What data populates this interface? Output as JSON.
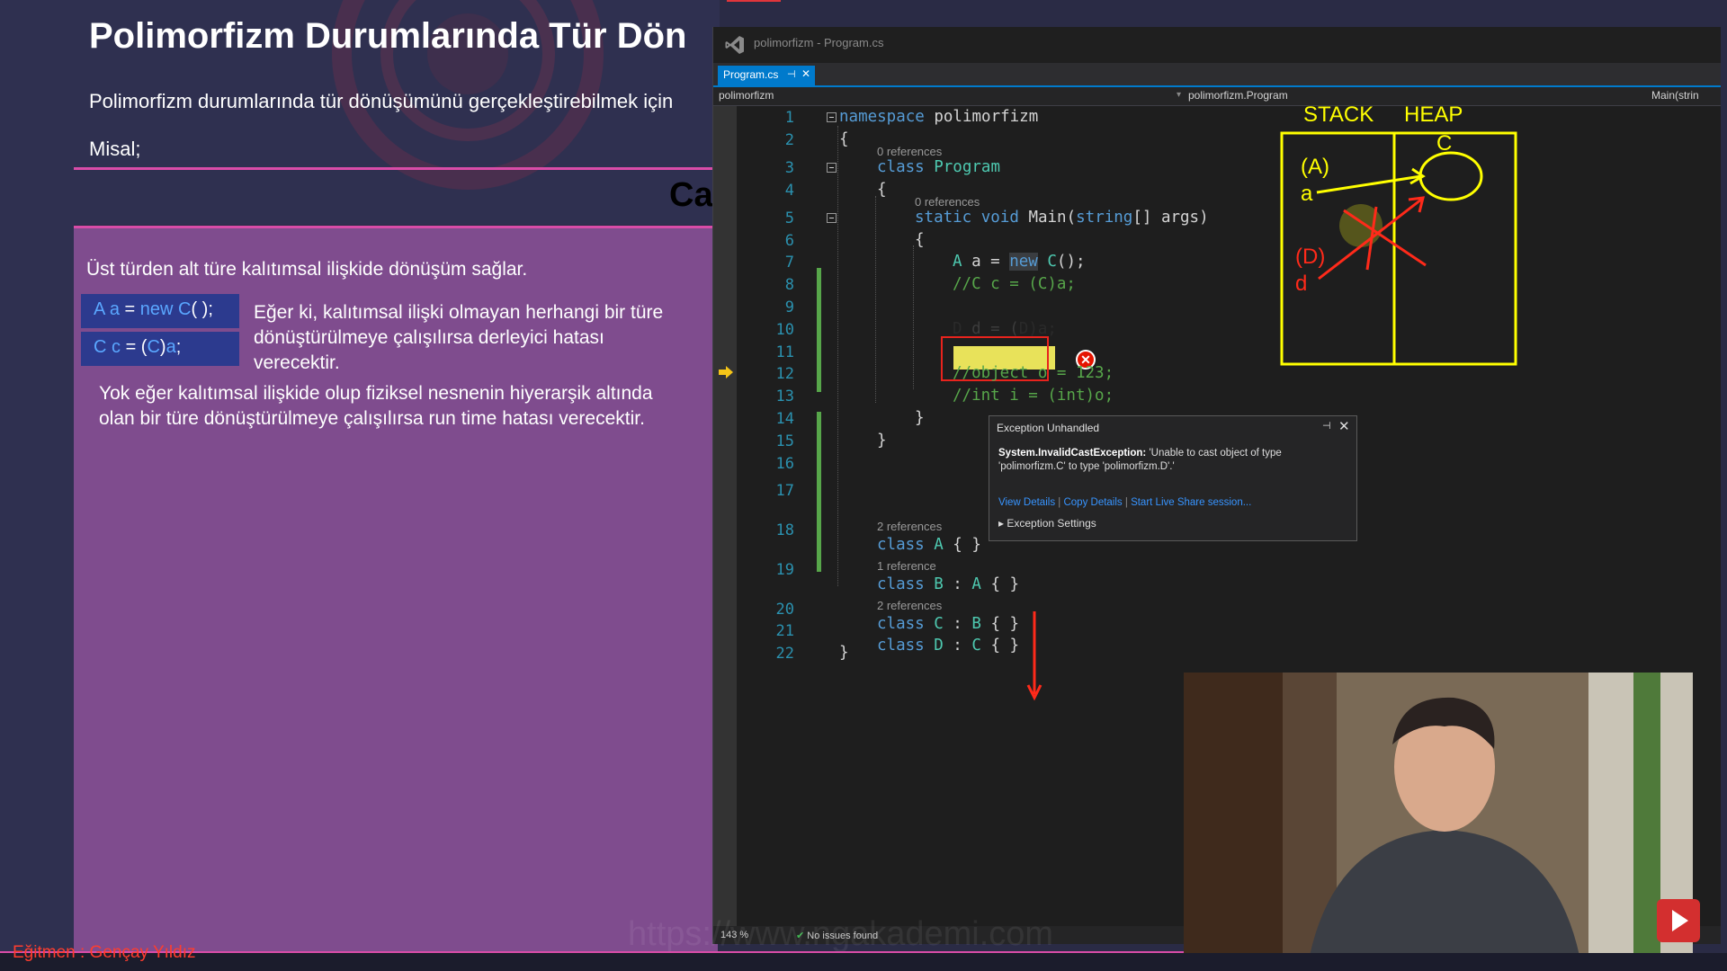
{
  "slide": {
    "title": "Polimorfizm Durumlarında Tür Dön",
    "subtitle": "Polimorfizm durumlarında tür dönüşümünü gerçekleştirebilmek için",
    "misal": "Misal;",
    "section_cut": "Ca",
    "paragraph1": "Üst türden alt türe kalıtımsal ilişkide dönüşüm sağlar.",
    "code_line1": {
      "type": "A",
      "var": "a",
      "eq": " = ",
      "new": "new",
      "cls": " C",
      "rest": "( );"
    },
    "code_line2": {
      "type": "C",
      "var": "c",
      "eq": " = (",
      "cast": "C",
      "close": ")",
      "obj": "a",
      "end": ";"
    },
    "side_text": "Eğer ki, kalıtımsal ilişki olmayan herhangi bir türe dönüştürülmeye çalışılırsa derleyici hatası verecektir.",
    "paragraph2": "Yok eğer kalıtımsal ilişkide olup fiziksel nesnenin hiyerarşik altında olan bir türe dönüştürülmeye çalışılırsa run time hatası verecektir.",
    "instructor": "Eğitmen : Gençay Yıldız",
    "watermark": "https://www.ngakademi.com"
  },
  "ide": {
    "window_title": "polimorfizm - Program.cs",
    "tab": {
      "label": "Program.cs",
      "pin": "⊣",
      "close": "✕"
    },
    "nav": {
      "project": "polimorfizm",
      "class": "polimorfizm.Program",
      "member": "Main(strin"
    },
    "status": {
      "zoom": "143 %",
      "issues": "No issues found"
    },
    "refs": {
      "program": "0 references",
      "main": "0 references",
      "classA": "2 references",
      "classB": "1 reference",
      "classC": "2 references"
    },
    "line_numbers": [
      "1",
      "2",
      "3",
      "4",
      "5",
      "6",
      "7",
      "8",
      "9",
      "10",
      "11",
      "12",
      "13",
      "14",
      "15",
      "16",
      "17",
      "18",
      "19",
      "20",
      "21",
      "22"
    ],
    "code": {
      "l1_kw": "namespace",
      "l1_name": " polimorfizm",
      "l2": "{",
      "l3_kw": "class",
      "l3_name": " Program",
      "l4": "{",
      "l5_a": "static",
      "l5_b": " void",
      "l5_c": " Main(",
      "l5_d": "string",
      "l5_e": "[] args)",
      "l6": "{",
      "l7_a": "A",
      "l7_b": " a = ",
      "l7_c": "new",
      "l7_d": " C",
      "l7_e": "();",
      "l8": "//C c = (C)a;",
      "l10_a": "D",
      "l10_b": " d = (",
      "l10_c": "D",
      "l10_d": ")a;",
      "l12": "//object o = 123;",
      "l13": "//int i = (int)o;",
      "l14": "}",
      "l15": "}",
      "l17_kw": "class",
      "l17_name": " A",
      "l17_rest": " { }",
      "l18_kw": "class",
      "l18_name": " B",
      "l18_rest": " : ",
      "l18_base": "A",
      "l18_end": " { }",
      "l19_kw": "class",
      "l19_name": " C",
      "l19_rest": " : ",
      "l19_base": "B",
      "l19_end": " { }",
      "l20_kw": "class",
      "l20_name": " D",
      "l20_rest": " : ",
      "l20_base": "C",
      "l20_end": " { }",
      "l21": "}"
    },
    "exception": {
      "title": "Exception Unhandled",
      "type": "System.InvalidCastException:",
      "message": " 'Unable to cast object of type 'polimorfizm.C' to type 'polimorfizm.D'.'",
      "link1": "View Details",
      "link2": "Copy Details",
      "link3": "Start Live Share session...",
      "settings": "Exception Settings"
    }
  },
  "drawing": {
    "stack": "STACK",
    "heap": "HEAP",
    "label_A": "(A)",
    "label_a": "a",
    "label_C": "C",
    "label_D": "(D)",
    "label_d": "d",
    "color_yellow": "#ffff00",
    "color_red": "#ff2a1a"
  },
  "colors": {
    "keyword": "#569cd6",
    "type": "#4ec9b0",
    "comment": "#57a64a",
    "slide_body": "#7f4c8e",
    "accent_pink": "#d94ca8"
  }
}
